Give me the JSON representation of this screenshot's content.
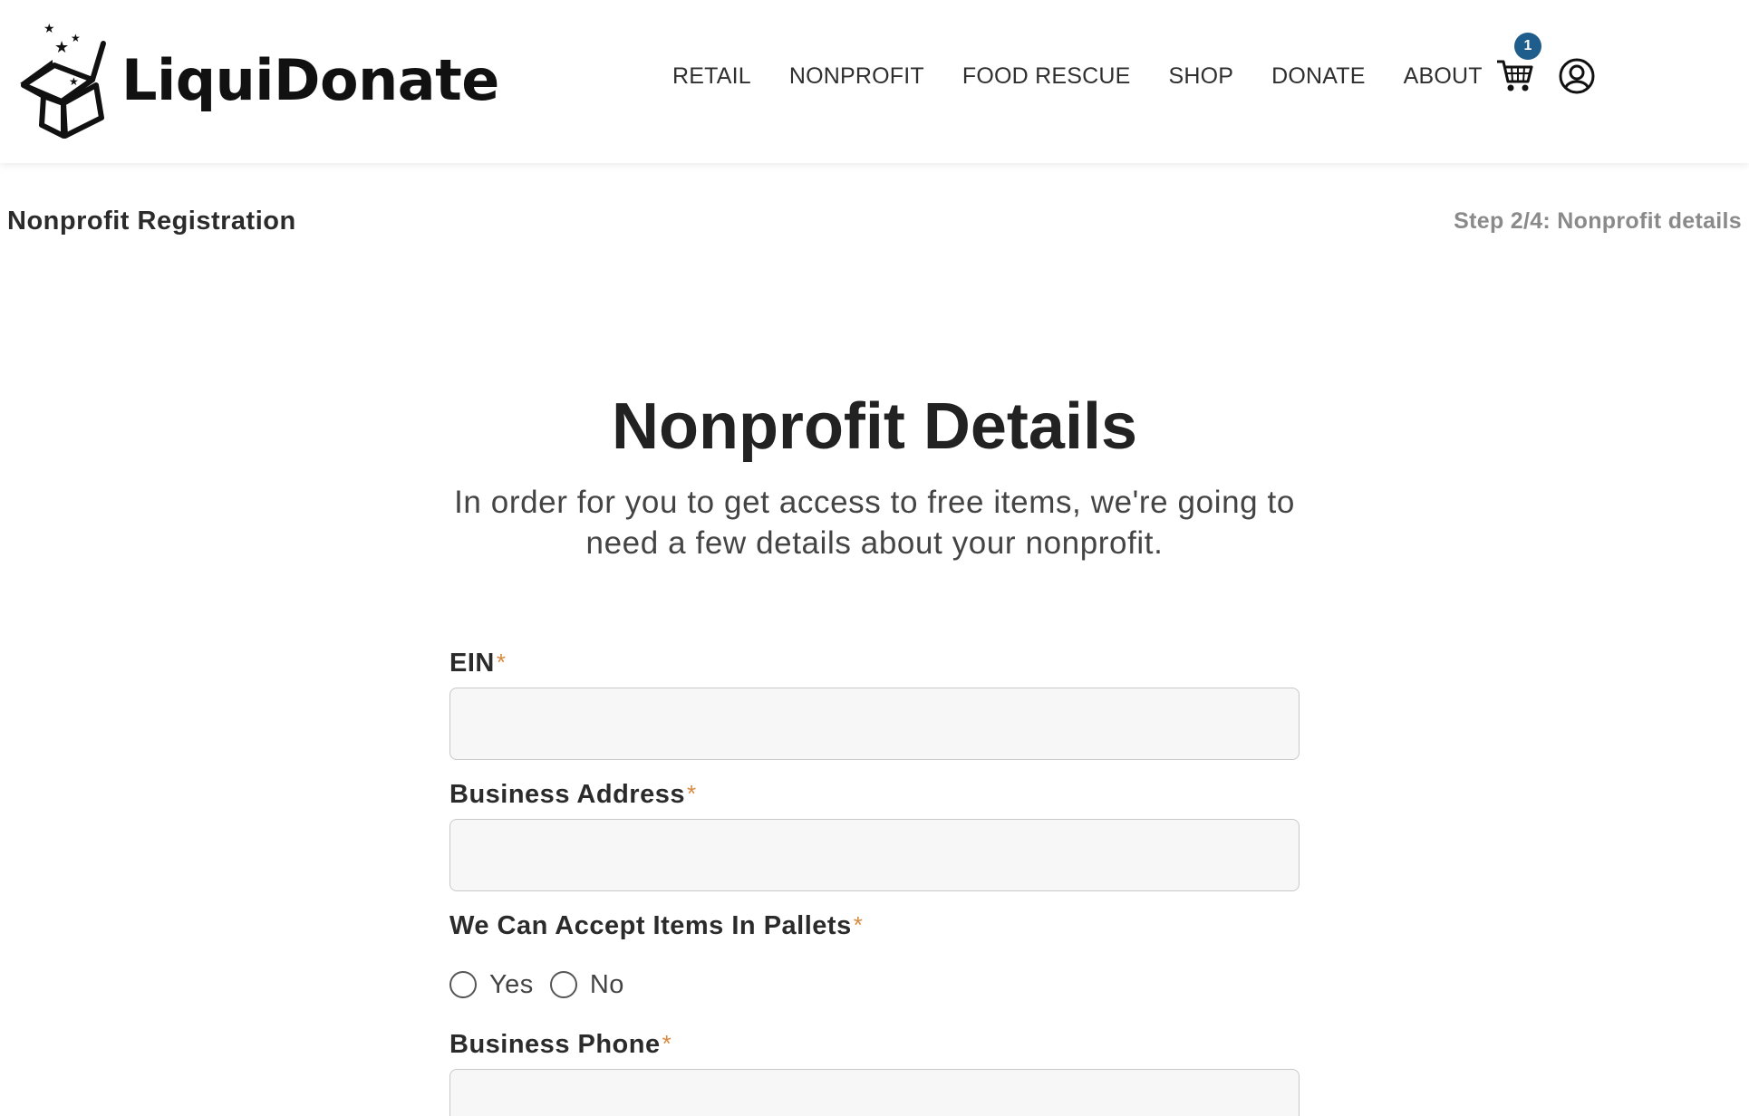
{
  "header": {
    "brand": "LiquiDonate",
    "nav": [
      {
        "label": "RETAIL"
      },
      {
        "label": "NONPROFIT"
      },
      {
        "label": "FOOD RESCUE"
      },
      {
        "label": "SHOP"
      },
      {
        "label": "DONATE"
      },
      {
        "label": "ABOUT"
      }
    ],
    "cart_count": "1",
    "cart_icon": "cart-icon",
    "account_icon": "account-icon",
    "badge_color": "#1f5d8c"
  },
  "page": {
    "registration_title": "Nonprofit Registration",
    "step": "Step 2/4: Nonprofit details",
    "title": "Nonprofit Details",
    "intro": "In order for you to get access to free items, we're going to need a few details about your nonprofit."
  },
  "form": {
    "required_mark": "*",
    "required_color": "#d78a3f",
    "ein": {
      "label": "EIN",
      "value": ""
    },
    "business_address": {
      "label": "Business Address",
      "value": ""
    },
    "pallets": {
      "label": "We Can Accept Items In Pallets",
      "options": [
        "Yes",
        "No"
      ],
      "selected": null
    },
    "business_phone": {
      "label": "Business Phone",
      "value": ""
    }
  }
}
